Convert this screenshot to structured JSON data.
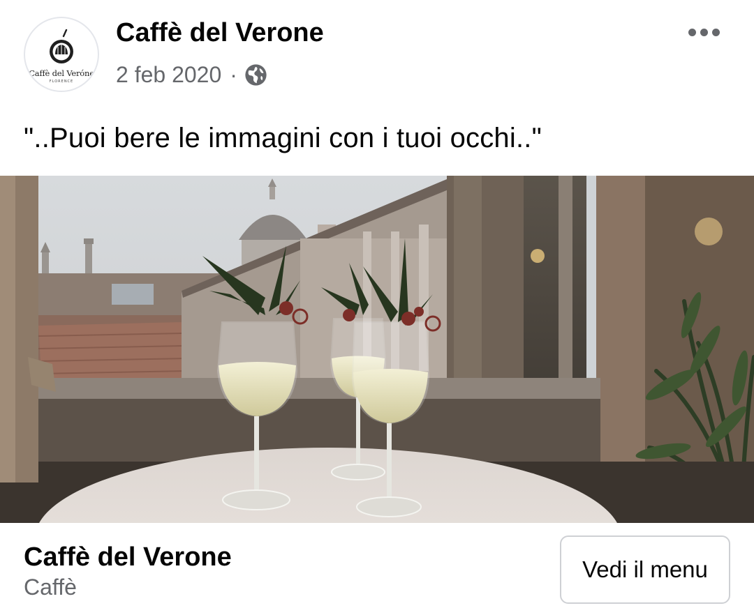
{
  "post": {
    "author": "Caffè del Verone",
    "date": "2 feb 2020",
    "separator": "·",
    "audience_icon": "globe-icon",
    "more_icon": "more-options-icon",
    "text": "\"..Puoi bere le immagini con i tuoi occhi..\""
  },
  "avatar": {
    "logo_text": "Caffè del Veróne",
    "logo_subtext": "FLORENCE"
  },
  "photo": {
    "subject": "three-wine-glasses-duomo-view"
  },
  "footer": {
    "page_name": "Caffè del Verone",
    "category": "Caffè",
    "menu_button": "Vedi il menu"
  },
  "colors": {
    "primary_text": "#050505",
    "secondary_text": "#65676b",
    "border": "#ced0d4"
  }
}
